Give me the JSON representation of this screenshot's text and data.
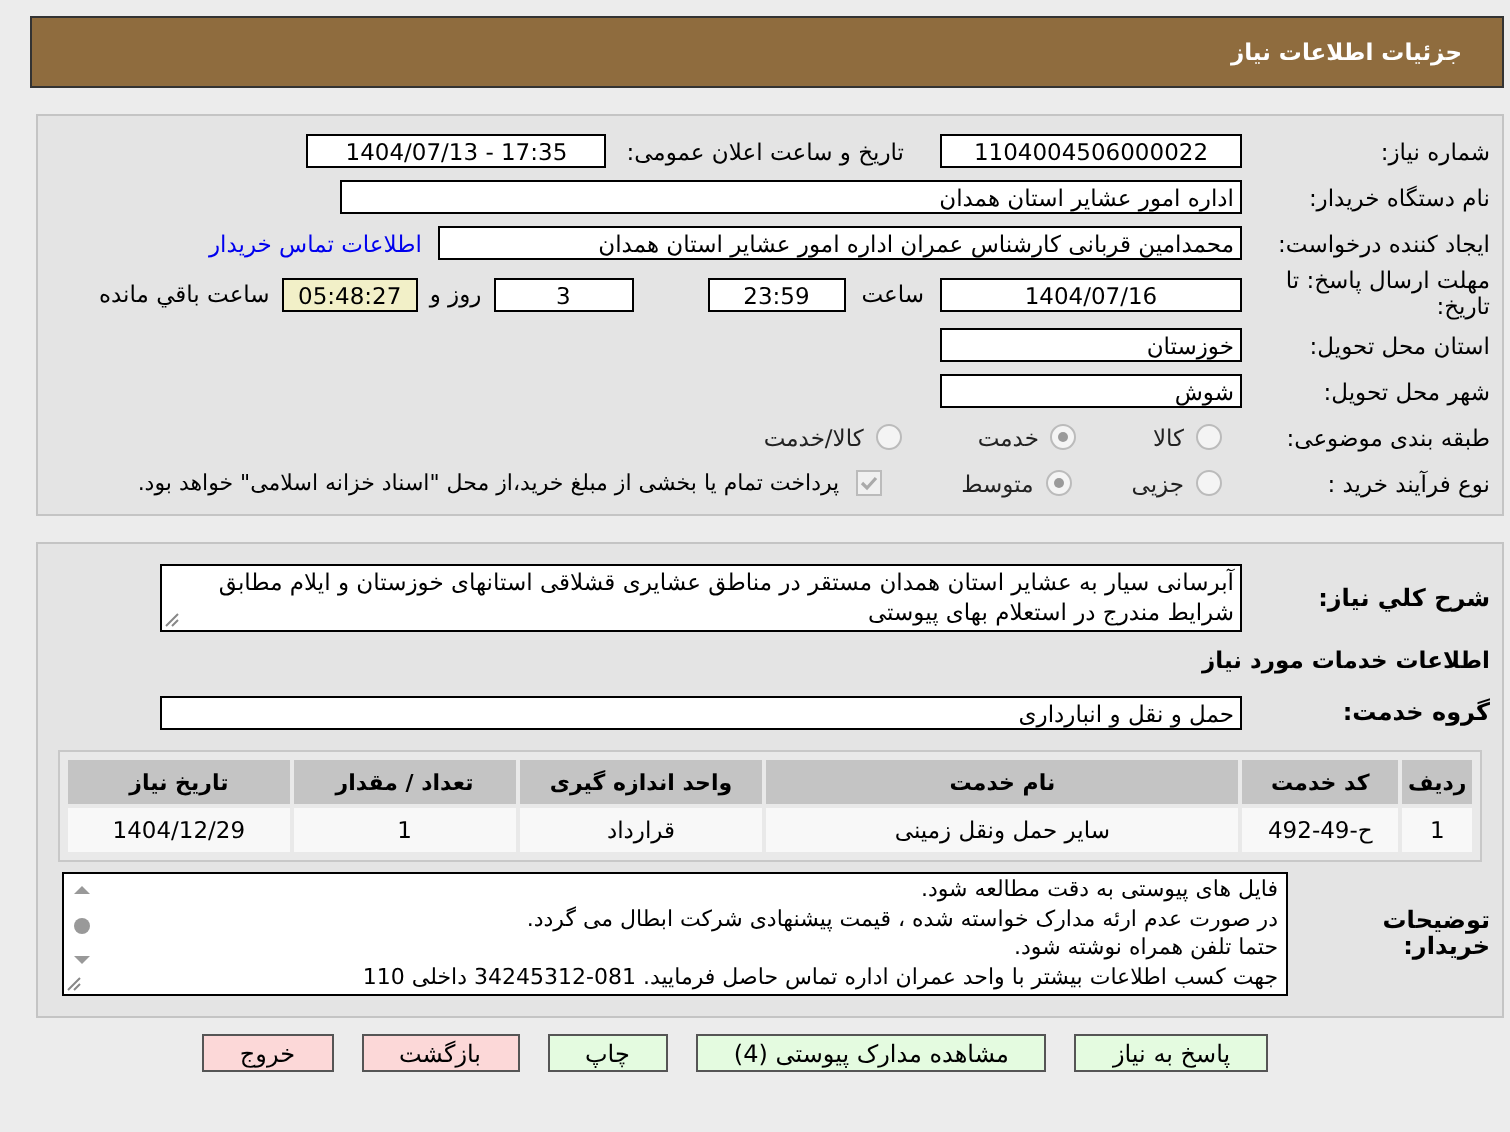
{
  "header": {
    "title": "جزئیات اطلاعات نیاز"
  },
  "need_number": {
    "label": "شماره نیاز:",
    "value": "1104004506000022"
  },
  "announce": {
    "label": "تاریخ و ساعت اعلان عمومی:",
    "value": "1404/07/13 - 17:35"
  },
  "buyer": {
    "label": "نام دستگاه خریدار:",
    "value": "اداره امور عشایر استان همدان"
  },
  "requester": {
    "label": "ایجاد کننده درخواست:",
    "value": "محمدامین قربانی کارشناس عمران اداره امور عشایر استان همدان",
    "link": "اطلاعات تماس خریدار"
  },
  "deadline": {
    "label": "مهلت ارسال پاسخ: تا تاریخ:",
    "date": "1404/07/16",
    "time_label": "ساعت",
    "time": "23:59",
    "days": "3",
    "days_label": "روز و",
    "remaining": "05:48:27",
    "remaining_label": "ساعت باقي مانده"
  },
  "province": {
    "label": "استان محل تحویل:",
    "value": "خوزستان"
  },
  "city": {
    "label": "شهر محل تحویل:",
    "value": "شوش"
  },
  "category": {
    "label": "طبقه بندی موضوعی:",
    "options": [
      {
        "label": "کالا",
        "selected": false
      },
      {
        "label": "خدمت",
        "selected": true
      },
      {
        "label": "کالا/خدمت",
        "selected": false
      }
    ]
  },
  "purchase_type": {
    "label": "نوع فرآیند خرید :",
    "options": [
      {
        "label": "جزیی",
        "selected": false
      },
      {
        "label": "متوسط",
        "selected": true
      }
    ],
    "payment": {
      "checked": true,
      "text": "پرداخت تمام یا بخشی از مبلغ خرید،از محل \"اسناد خزانه اسلامی\" خواهد بود."
    }
  },
  "description": {
    "label": "شرح کلي نياز:",
    "text": "آبرسانی سیار به عشایر استان همدان مستقر در مناطق عشایری قشلاقی استانهای خوزستان و ایلام مطابق شرایط مندرج در استعلام بهای پیوستی"
  },
  "services_heading": "اطلاعات خدمات مورد نیاز",
  "service_group": {
    "label": "گروه خدمت:",
    "value": "حمل و نقل و انبارداری"
  },
  "table": {
    "columns": [
      "ردیف",
      "کد خدمت",
      "نام خدمت",
      "واحد اندازه گیری",
      "تعداد / مقدار",
      "تاریخ نیاز"
    ],
    "rows": [
      [
        "1",
        "ح-49-492",
        "سایر حمل ونقل زمینی",
        "قرارداد",
        "1",
        "1404/12/29"
      ]
    ]
  },
  "notes": {
    "label": "توضیحات خریدار:",
    "lines": [
      "فایل های پیوستی به دقت مطالعه شود.",
      "در صورت عدم ارئه مدارک خواسته شده ، قیمت پیشنهادی شرکت ابطال می گردد.",
      "حتما تلفن همراه نوشته شود.",
      "جهت کسب اطلاعات بیشتر با واحد عمران اداره تماس حاصل فرمایید. 081-34245312  داخلی 110"
    ]
  },
  "buttons": [
    {
      "label": "پاسخ به نیاز",
      "kind": "go"
    },
    {
      "label": "مشاهده مدارک پیوستی (4)",
      "kind": "go"
    },
    {
      "label": "چاپ",
      "kind": "go"
    },
    {
      "label": "بازگشت",
      "kind": "stop"
    },
    {
      "label": "خروج",
      "kind": "stop"
    }
  ]
}
